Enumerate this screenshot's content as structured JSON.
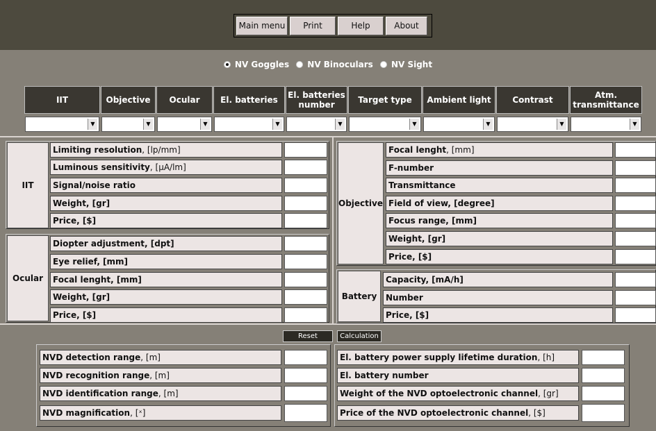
{
  "menu": [
    "Main menu",
    "Print",
    "Help",
    "About"
  ],
  "device_types": [
    {
      "label": "NV Goggles",
      "selected": true
    },
    {
      "label": "NV Binoculars",
      "selected": false
    },
    {
      "label": "NV Sight",
      "selected": false
    }
  ],
  "columns": [
    "IIT",
    "Objective",
    "Ocular",
    "El. batteries",
    "El. batteries number",
    "Target type",
    "Ambient light",
    "Contrast",
    "Atm. transmittance"
  ],
  "iit": {
    "title": "IIT",
    "rows": [
      {
        "name": "Limiting resolution",
        "unit": ", [lp/mm]"
      },
      {
        "name": "Luminous sensitivity",
        "unit": ", [µA/lm]"
      },
      {
        "name": "Signal/noise ratio",
        "unit": ""
      },
      {
        "name": "Weight, [gr]",
        "unit": ""
      },
      {
        "name": "Price, [$]",
        "unit": ""
      }
    ]
  },
  "ocular": {
    "title": "Ocular",
    "rows": [
      {
        "name": "Diopter adjustment, [dpt]",
        "unit": ""
      },
      {
        "name": "Eye relief, [mm]",
        "unit": ""
      },
      {
        "name": "Focal lenght, [mm]",
        "unit": ""
      },
      {
        "name": "Weight, [gr]",
        "unit": ""
      },
      {
        "name": "Price, [$]",
        "unit": ""
      }
    ]
  },
  "objective": {
    "title": "Objective",
    "rows": [
      {
        "name": "Focal lenght",
        "unit": ", [mm]"
      },
      {
        "name": "F-number",
        "unit": ""
      },
      {
        "name": "Transmittance",
        "unit": ""
      },
      {
        "name": "Field of view, [degree]",
        "unit": ""
      },
      {
        "name": "Focus range, [mm]",
        "unit": ""
      },
      {
        "name": "Weight, [gr]",
        "unit": ""
      },
      {
        "name": "Price, [$]",
        "unit": ""
      }
    ]
  },
  "battery": {
    "title": "Battery",
    "rows": [
      {
        "name": "Capacity, [mA/h]",
        "unit": ""
      },
      {
        "name": "Number",
        "unit": ""
      },
      {
        "name": "Price, [$]",
        "unit": ""
      }
    ]
  },
  "buttons": {
    "reset": "Reset",
    "calculation": "Calculation"
  },
  "results_left": [
    {
      "name": "NVD detection range",
      "unit": ", [m]"
    },
    {
      "name": "NVD recognition range",
      "unit": ", [m]"
    },
    {
      "name": "NVD identification range",
      "unit": ", [m]"
    },
    {
      "name": "NVD magnification",
      "unit": ", [ˣ]"
    }
  ],
  "results_right": [
    {
      "name": "El. battery power supply lifetime duration",
      "unit": ", [h]"
    },
    {
      "name": "El. battery number",
      "unit": ""
    },
    {
      "name": "Weight of the NVD optoelectronic channel",
      "unit": ", [gr]"
    },
    {
      "name": "Price of the NVD optoelectronic channel",
      "unit": ", [$]"
    }
  ]
}
